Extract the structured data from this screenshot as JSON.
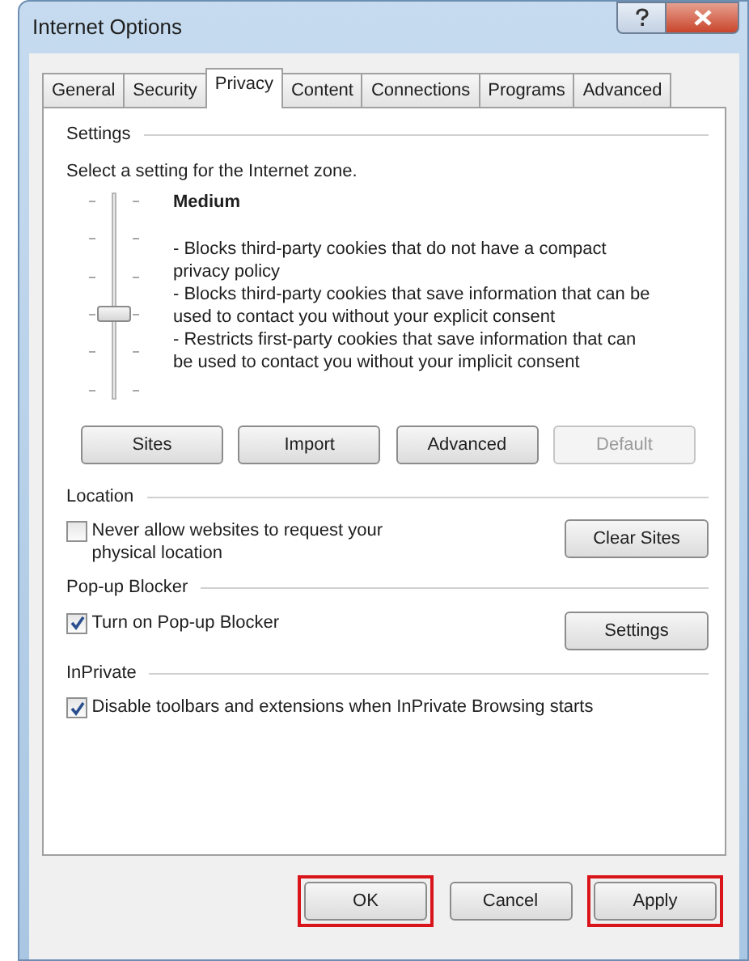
{
  "window": {
    "title": "Internet Options"
  },
  "tabs": [
    {
      "label": "General",
      "selected": false
    },
    {
      "label": "Security",
      "selected": false
    },
    {
      "label": "Privacy",
      "selected": true
    },
    {
      "label": "Content",
      "selected": false
    },
    {
      "label": "Connections",
      "selected": false
    },
    {
      "label": "Programs",
      "selected": false
    },
    {
      "label": "Advanced",
      "selected": false
    }
  ],
  "settings": {
    "heading": "Settings",
    "prompt": "Select a setting for the Internet zone.",
    "slider": {
      "level": 0.4
    },
    "level_name": "Medium",
    "description": [
      "- Blocks third-party cookies that do not have a compact privacy policy",
      "- Blocks third-party cookies that save information that can be used to contact you without your explicit consent",
      "- Restricts first-party cookies that save information that can be used to contact you without your implicit consent"
    ],
    "buttons": [
      {
        "label": "Sites",
        "disabled": false
      },
      {
        "label": "Import",
        "disabled": false
      },
      {
        "label": "Advanced",
        "disabled": false
      },
      {
        "label": "Default",
        "disabled": true
      }
    ]
  },
  "location": {
    "heading": "Location",
    "checkbox": {
      "label": "Never allow websites to request your physical location",
      "checked": false
    },
    "button": "Clear Sites"
  },
  "popup_blocker": {
    "heading": "Pop-up Blocker",
    "checkbox": {
      "label": "Turn on Pop-up Blocker",
      "checked": true
    },
    "button": "Settings"
  },
  "inprivate": {
    "heading": "InPrivate",
    "checkbox": {
      "label": "Disable toolbars and extensions when InPrivate Browsing starts",
      "checked": true
    }
  },
  "footer_buttons": [
    {
      "label": "OK",
      "highlighted": true
    },
    {
      "label": "Cancel",
      "highlighted": false
    },
    {
      "label": "Apply",
      "highlighted": true
    }
  ]
}
